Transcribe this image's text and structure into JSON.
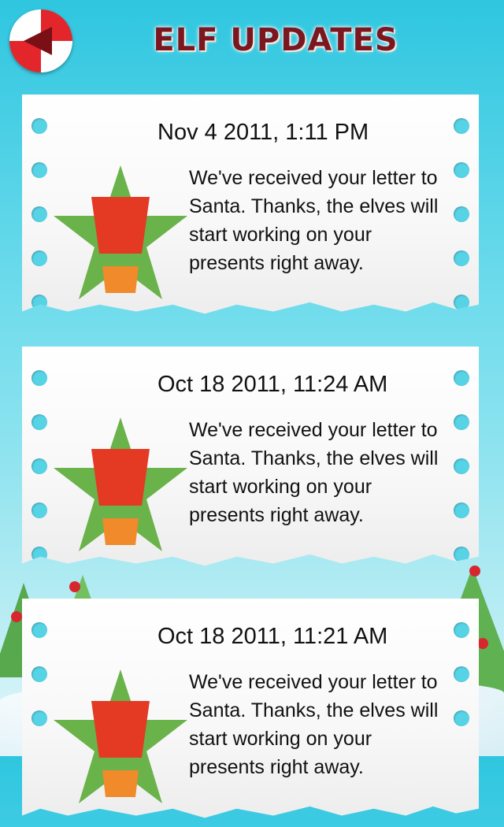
{
  "header": {
    "title": "ELF UPDATES",
    "back_icon": "candy-back-arrow-icon"
  },
  "colors": {
    "background_top": "#2fc6e0",
    "title": "#7a1720",
    "star_green": "#6ab24a",
    "exclamation_red": "#e43a24",
    "exclamation_orange": "#f08a2a"
  },
  "updates": [
    {
      "date": "Nov 4 2011, 1:11 PM",
      "message": "We've received your letter to Santa. Thanks, the elves will start working on your presents right away."
    },
    {
      "date": "Oct 18 2011, 11:24 AM",
      "message": "We've received your letter to Santa. Thanks, the elves will start working on your presents right away."
    },
    {
      "date": "Oct 18 2011, 11:21 AM",
      "message": "We've received your letter to Santa. Thanks, the elves will start working on your presents right away."
    }
  ]
}
